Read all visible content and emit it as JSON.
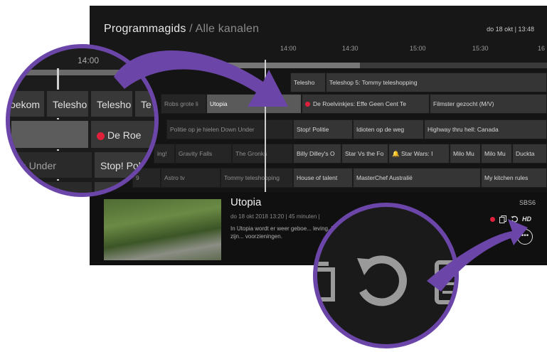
{
  "header": {
    "title": "Programmagids",
    "separator": " / ",
    "subtitle": "Alle kanalen",
    "datetime": "do 18 okt | 13:48"
  },
  "timeline": {
    "ticks": [
      "14:00",
      "14:30",
      "15:00",
      "15:30",
      "16"
    ],
    "zoom_tick": "14:00"
  },
  "rows": [
    [
      {
        "text": "Telesho",
        "past": false
      },
      {
        "text": "Teleshop 5: Tommy teleshopping",
        "past": false
      }
    ],
    [
      {
        "text": "Robs grote li",
        "past": true
      },
      {
        "text": "Utopia",
        "selected": true
      },
      {
        "text": "De Roelvinkjes: Effe Geen Cent Te",
        "record": true
      },
      {
        "text": "Filmster gezocht (M/V)"
      }
    ],
    [
      {
        "text": "Politie op je hielen Down Under",
        "past": true
      },
      {
        "text": "Stop! Politie"
      },
      {
        "text": "Idioten op de weg"
      },
      {
        "text": "Highway thru hell: Canada"
      }
    ],
    [
      {
        "text": "ing!",
        "past": true
      },
      {
        "text": "Gravity Falls",
        "past": true
      },
      {
        "text": "The Gronks",
        "past": true
      },
      {
        "text": "Billy Dilley's O"
      },
      {
        "text": "Star Vs the Fo"
      },
      {
        "text": "Star Wars: I",
        "bell": true
      },
      {
        "text": "Milo Mu"
      },
      {
        "text": "Milo Mu"
      },
      {
        "text": "Duckta"
      }
    ],
    [
      {
        "text": "9",
        "past": true
      },
      {
        "text": "Astro tv",
        "past": true
      },
      {
        "text": "Tommy teleshopping",
        "past": true
      },
      {
        "text": "House of talent"
      },
      {
        "text": "MasterChef Australië"
      },
      {
        "text": "My kitchen rules"
      }
    ]
  ],
  "detail": {
    "title": "Utopia",
    "meta": "do 18 okt 2018 13:20 | 45 minuten |",
    "description": "In Utopia wordt er weer geboe... leving. M... keer betekent from scratch o... en er zijn... voorzieningen.",
    "channel": "SBS6",
    "hd": "HD",
    "more": "•••"
  },
  "zoom_left": {
    "cells": [
      "oekom",
      "Telesho",
      "Telesho",
      "Te",
      "De Roe",
      "wn Under",
      "Stop! Politi"
    ]
  },
  "colors": {
    "accent": "#6b46a8",
    "record": "#e0203a",
    "screen_bg": "#141414"
  },
  "icons": [
    "record-dot-icon",
    "copy-icon",
    "replay-icon",
    "more-icon",
    "bell-icon",
    "folder-icon",
    "list-icon"
  ]
}
